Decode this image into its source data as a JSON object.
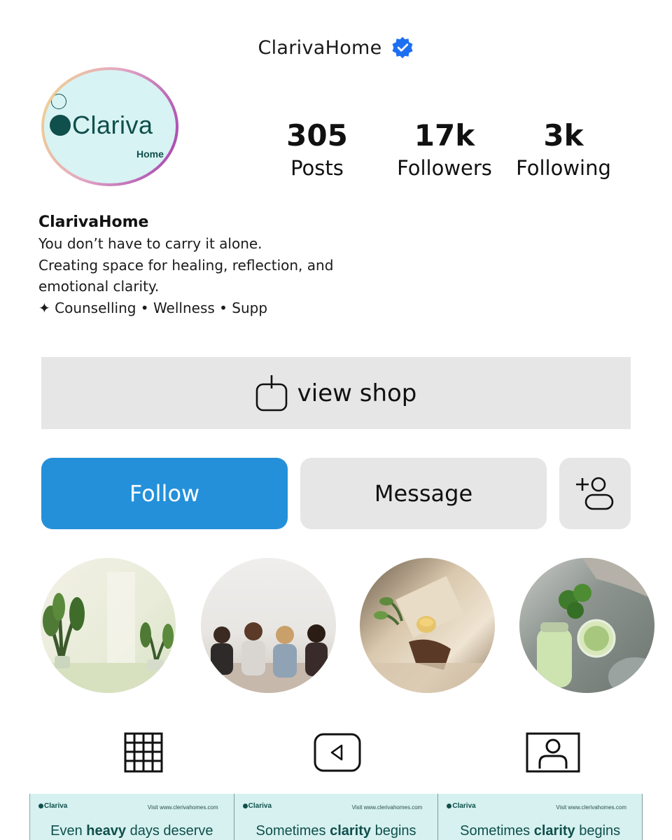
{
  "header": {
    "username": "ClarivaHome",
    "verified_icon": "verified-badge-icon",
    "verified_color": "#1d6ff2"
  },
  "avatar": {
    "logo_text": "Clariva",
    "logo_sub": "Home",
    "ring_colors": [
      "#f3d88a",
      "#e3a7c4",
      "#a03cae"
    ],
    "bg_color": "#d8f3f3",
    "brand_color": "#0f4f4c"
  },
  "stats": {
    "posts": {
      "value": "305",
      "label": "Posts"
    },
    "followers": {
      "value": "17k",
      "label": "Followers"
    },
    "following": {
      "value": "3k",
      "label": "Following"
    }
  },
  "bio": {
    "name": "ClarivaHome",
    "lines": [
      "You don’t have to carry it alone.",
      "Creating space for healing, reflection, and",
      "emotional clarity.",
      "✦ Counselling • Wellness • Supp"
    ]
  },
  "shop_button": {
    "label": "view shop",
    "icon": "shopping-bag-icon"
  },
  "actions": {
    "follow_label": "Follow",
    "message_label": "Message",
    "add_user_icon": "add-user-icon",
    "follow_color": "#2490d9"
  },
  "highlights": [
    {
      "name": "plants-room"
    },
    {
      "name": "group-friends"
    },
    {
      "name": "tea-reading"
    },
    {
      "name": "matcha-drink"
    }
  ],
  "tabs": [
    {
      "icon": "grid-icon"
    },
    {
      "icon": "reels-icon"
    },
    {
      "icon": "tagged-icon"
    }
  ],
  "posts": [
    {
      "logo": "Clariva",
      "visit": "Visit www.clerivahomes.com",
      "head_pre": "Even ",
      "head_bold": "heavy",
      "head_post": " days deserve"
    },
    {
      "logo": "Clariva",
      "visit": "Visit www.clerivahomes.com",
      "head_pre": "Sometimes ",
      "head_bold": "clarity",
      "head_post": " begins"
    },
    {
      "logo": "Clariva",
      "visit": "Visit www.clerivahomes.com",
      "head_pre": "Sometimes ",
      "head_bold": "clarity",
      "head_post": " begins"
    }
  ]
}
